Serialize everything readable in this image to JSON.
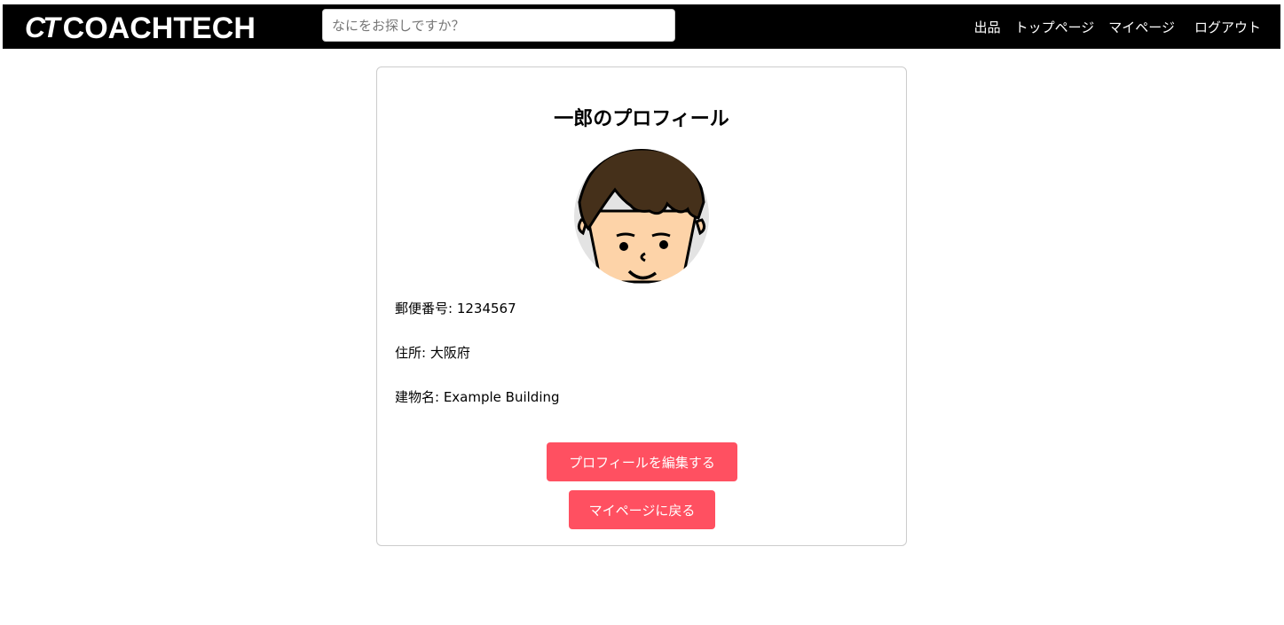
{
  "header": {
    "logo": "COACHTECH",
    "logo_mark": "CT",
    "search_placeholder": "なにをお探しですか？",
    "nav": [
      "出品",
      "トップページ",
      "マイページ",
      "ログアウト"
    ]
  },
  "profile": {
    "title": "一郎のプロフィール",
    "postal": "郵便番号: 1234567",
    "address": "住所: 大阪府",
    "building": "建物名: Example Building",
    "edit_button": "プロフィールを編集する",
    "back_button": "マイページに戻る"
  },
  "colors": {
    "accent": "#ff5061",
    "header_bg": "#000000"
  }
}
